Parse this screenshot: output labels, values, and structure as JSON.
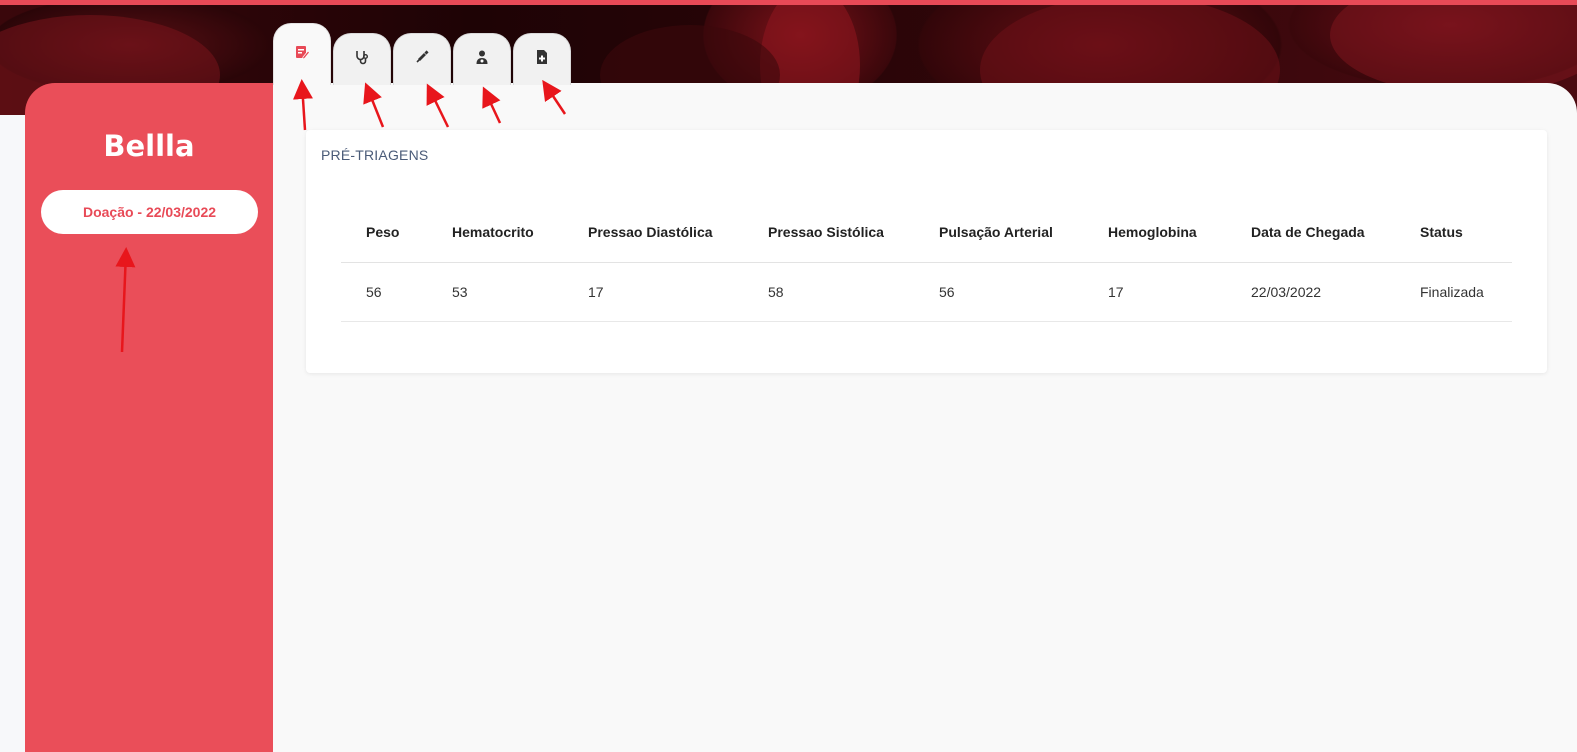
{
  "sidebar": {
    "patient_name": "Bellla",
    "donation_label": "Doação - 22/03/2022"
  },
  "tabs": [
    {
      "icon": "pre-triage-icon",
      "active": true
    },
    {
      "icon": "stethoscope-icon",
      "active": false
    },
    {
      "icon": "syringe-icon",
      "active": false
    },
    {
      "icon": "doctor-icon",
      "active": false
    },
    {
      "icon": "medical-file-icon",
      "active": false
    }
  ],
  "card": {
    "title": "PRÉ-TRIAGENS",
    "columns": [
      "Peso",
      "Hematocrito",
      "Pressao Diastólica",
      "Pressao Sistólica",
      "Pulsação Arterial",
      "Hemoglobina",
      "Data de Chegada",
      "Status"
    ],
    "rows": [
      [
        "56",
        "53",
        "17",
        "58",
        "56",
        "17",
        "22/03/2022",
        "Finalizada"
      ]
    ]
  },
  "colors": {
    "accent": "#e84a57",
    "sidebar": "#ea4e59",
    "annotation_arrow": "#e8161c"
  }
}
